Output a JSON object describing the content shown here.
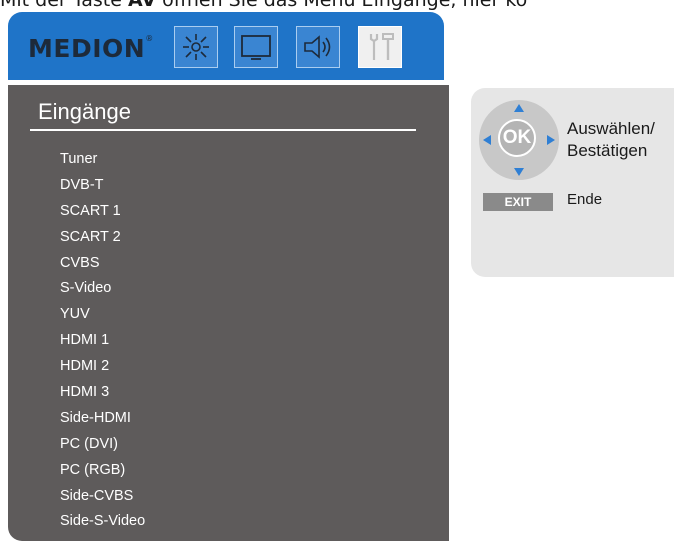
{
  "caption": {
    "prefix": "Mit der Taste ",
    "key": "AV",
    "suffix": " öffnen Sie das Menü Eingänge, hier kö"
  },
  "menubar": {
    "logo": "MEDION",
    "logo_mark": "®",
    "icons": [
      "brightness-icon",
      "screen-icon",
      "speaker-icon",
      "tools-icon"
    ],
    "active_icon": "tools-icon"
  },
  "menu": {
    "title": "Eingänge",
    "items": [
      "Tuner",
      "DVB-T",
      "SCART 1",
      "SCART 2",
      "CVBS",
      "S-Video",
      "YUV",
      "HDMI 1",
      "HDMI 2",
      "HDMI 3",
      "Side-HDMI",
      "PC (DVI)",
      "PC (RGB)",
      "Side-CVBS",
      "Side-S-Video"
    ]
  },
  "help": {
    "ok_label": "OK",
    "select_line1": "Auswählen/",
    "select_line2": "Bestätigen",
    "exit_label": "EXIT",
    "exit_text": "Ende"
  },
  "colors": {
    "menubar": "#1f74c8",
    "menu_bg": "#5e5b5b",
    "help_bg": "#e6e6e6",
    "arrow": "#2f7fd4"
  }
}
